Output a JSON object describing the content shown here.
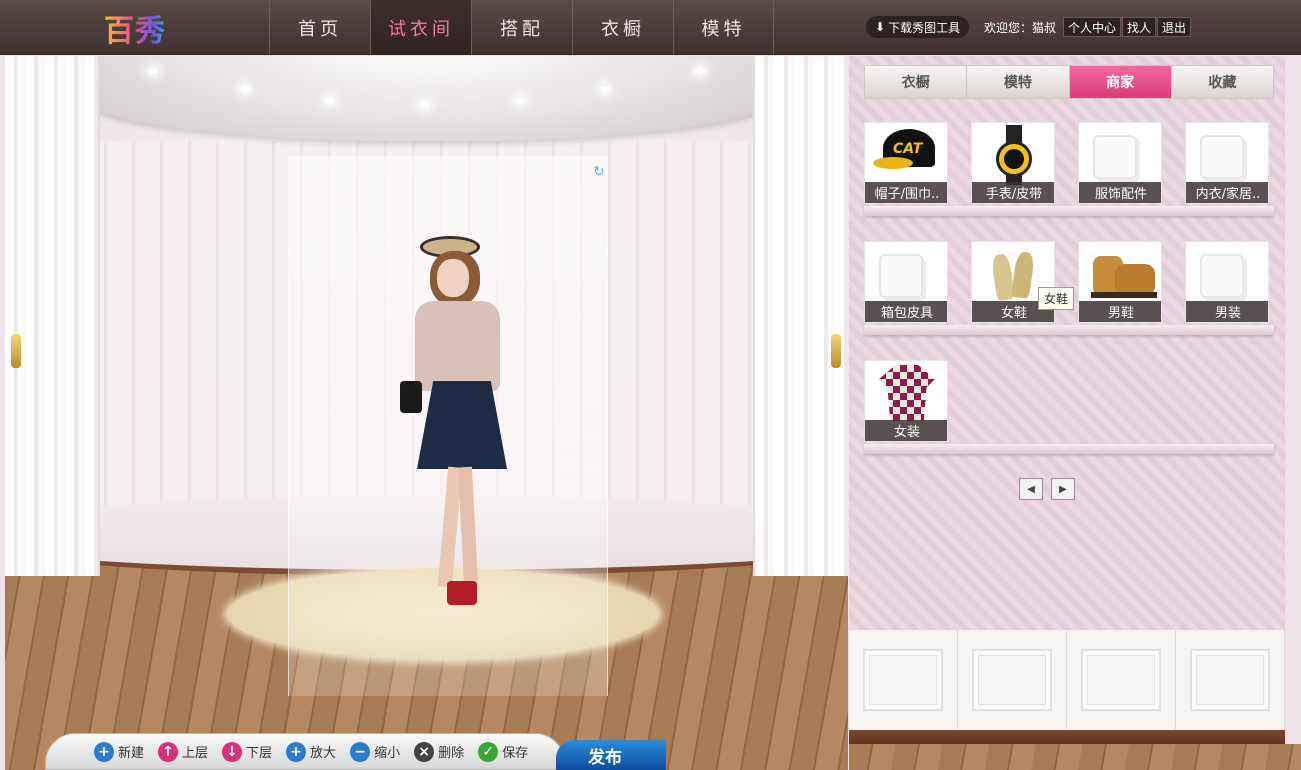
{
  "header": {
    "logo_text": "百秀",
    "nav": [
      {
        "label": "首页",
        "active": false
      },
      {
        "label": "试衣间",
        "active": true
      },
      {
        "label": "搭配",
        "active": false
      },
      {
        "label": "衣橱",
        "active": false
      },
      {
        "label": "模特",
        "active": false
      }
    ],
    "download_label": "下载秀图工具",
    "welcome": "欢迎您：猫叔",
    "links": {
      "profile": "个人中心",
      "find": "找人",
      "logout": "退出"
    }
  },
  "panel": {
    "tabs": [
      {
        "label": "衣橱",
        "active": false
      },
      {
        "label": "模特",
        "active": false
      },
      {
        "label": "商家",
        "active": true
      },
      {
        "label": "收藏",
        "active": false
      }
    ],
    "categories": [
      {
        "label": "帽子/围巾..",
        "icon": "cap-icon"
      },
      {
        "label": "手表/皮带",
        "icon": "watch-icon"
      },
      {
        "label": "服饰配件",
        "icon": "placeholder-icon"
      },
      {
        "label": "内衣/家居..",
        "icon": "placeholder-icon"
      },
      {
        "label": "箱包皮具",
        "icon": "placeholder-icon"
      },
      {
        "label": "女鞋",
        "icon": "heels-icon"
      },
      {
        "label": "男鞋",
        "icon": "boot-icon"
      },
      {
        "label": "男装",
        "icon": "placeholder-icon"
      },
      {
        "label": "女装",
        "icon": "sweater-icon"
      }
    ],
    "tooltip": "女鞋",
    "pager": {
      "prev": "◀",
      "next": "▶"
    }
  },
  "toolbar": {
    "buttons": [
      {
        "label": "新建",
        "icon": "plus-icon",
        "color": "#2e7bc9",
        "glyph": "+"
      },
      {
        "label": "上层",
        "icon": "arrow-up-icon",
        "color": "#d8307a",
        "glyph": "↑"
      },
      {
        "label": "下层",
        "icon": "arrow-down-icon",
        "color": "#d8307a",
        "glyph": "↓"
      },
      {
        "label": "放大",
        "icon": "zoom-in-icon",
        "color": "#2e7bc9",
        "glyph": "+"
      },
      {
        "label": "缩小",
        "icon": "zoom-out-icon",
        "color": "#2e7bc9",
        "glyph": "−"
      },
      {
        "label": "删除",
        "icon": "delete-icon",
        "color": "#444444",
        "glyph": "×"
      },
      {
        "label": "保存",
        "icon": "check-icon",
        "color": "#3aa63a",
        "glyph": "✓"
      }
    ],
    "publish_label": "发布"
  },
  "colors": {
    "accent": "#e0427f",
    "nav_bg": "#4a3b39",
    "publish": "#1565b8"
  }
}
